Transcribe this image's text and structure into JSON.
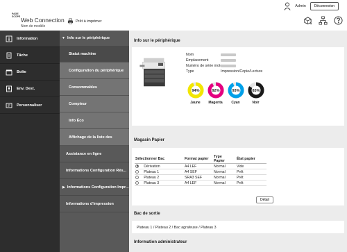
{
  "header": {
    "logo_text": "PAGE SCOPE",
    "app_title": "Web Connection",
    "model_label": "Nom de modèle",
    "model_value": "",
    "printer_status": "Prêt à imprimer",
    "user_name": "Admin",
    "logout_label": "Déconnexion",
    "tool_icons": [
      "refresh-icon",
      "sitemap-icon",
      "help-icon"
    ]
  },
  "nav": {
    "items": [
      {
        "label": "Information",
        "icon": "info-icon",
        "active": true
      },
      {
        "label": "Tâche",
        "icon": "job-icon"
      },
      {
        "label": "Boîte",
        "icon": "box-icon"
      },
      {
        "label": "Env. Dest.",
        "icon": "address-icon"
      },
      {
        "label": "Personnaliser",
        "icon": "custom-icon"
      }
    ]
  },
  "subnav": {
    "group_title": "Info sur le périphérique",
    "items": [
      "Statut machine",
      "Configuration du périphérique",
      "Consommables",
      "Compteur",
      "Info Éco",
      "Affichage de la liste des"
    ],
    "top_items": [
      {
        "label": "Assistance en ligne",
        "arrow": false
      },
      {
        "label": "Informations Configuration Rés...",
        "arrow": false
      },
      {
        "label": "Informations Configuration Impr...",
        "arrow": true
      },
      {
        "label": "Informations d'impression",
        "arrow": false
      }
    ]
  },
  "device_info": {
    "title": "Info sur le périphérique",
    "fields": [
      {
        "label": "Nom",
        "value": ""
      },
      {
        "label": "Emplacement",
        "value": ""
      },
      {
        "label": "Numéro de série moteur",
        "value": ""
      },
      {
        "label": "Type",
        "value": "Impression/Copie/Lecture"
      }
    ],
    "toners": [
      {
        "label": "Jaune",
        "percent": "94%",
        "level": 0.94,
        "color": "#f2e600"
      },
      {
        "label": "Magenta",
        "percent": "92%",
        "level": 0.92,
        "color": "#e4007f"
      },
      {
        "label": "Cyan",
        "percent": "93%",
        "level": 0.93,
        "color": "#00a0e9"
      },
      {
        "label": "Noir",
        "percent": "83%",
        "level": 0.83,
        "color": "#1a1a1a"
      }
    ]
  },
  "paper": {
    "title": "Magasin Papier",
    "columns": [
      "Sélectionner Bac",
      "Format papier",
      "Type Papier",
      "État papier"
    ],
    "rows": [
      {
        "selected": true,
        "tray": "Dérivation",
        "format": "A4 LEF",
        "type": "Normal",
        "state": "Vide"
      },
      {
        "selected": false,
        "tray": "Plateau 1",
        "format": "A4 SEF",
        "type": "Normal",
        "state": "Prêt"
      },
      {
        "selected": false,
        "tray": "Plateau 2",
        "format": "SRA3 SEF",
        "type": "Normal",
        "state": "Prêt"
      },
      {
        "selected": false,
        "tray": "Plateau 3",
        "format": "A4 LEF",
        "type": "Normal",
        "state": "Prêt"
      }
    ],
    "detail_label": "Détail"
  },
  "output": {
    "title": "Bac de sortie",
    "text": "Plateau 1 / Plateau 2 / Bac agrafeuse / Plateau 3"
  },
  "admin": {
    "title": "Information administrateur"
  }
}
